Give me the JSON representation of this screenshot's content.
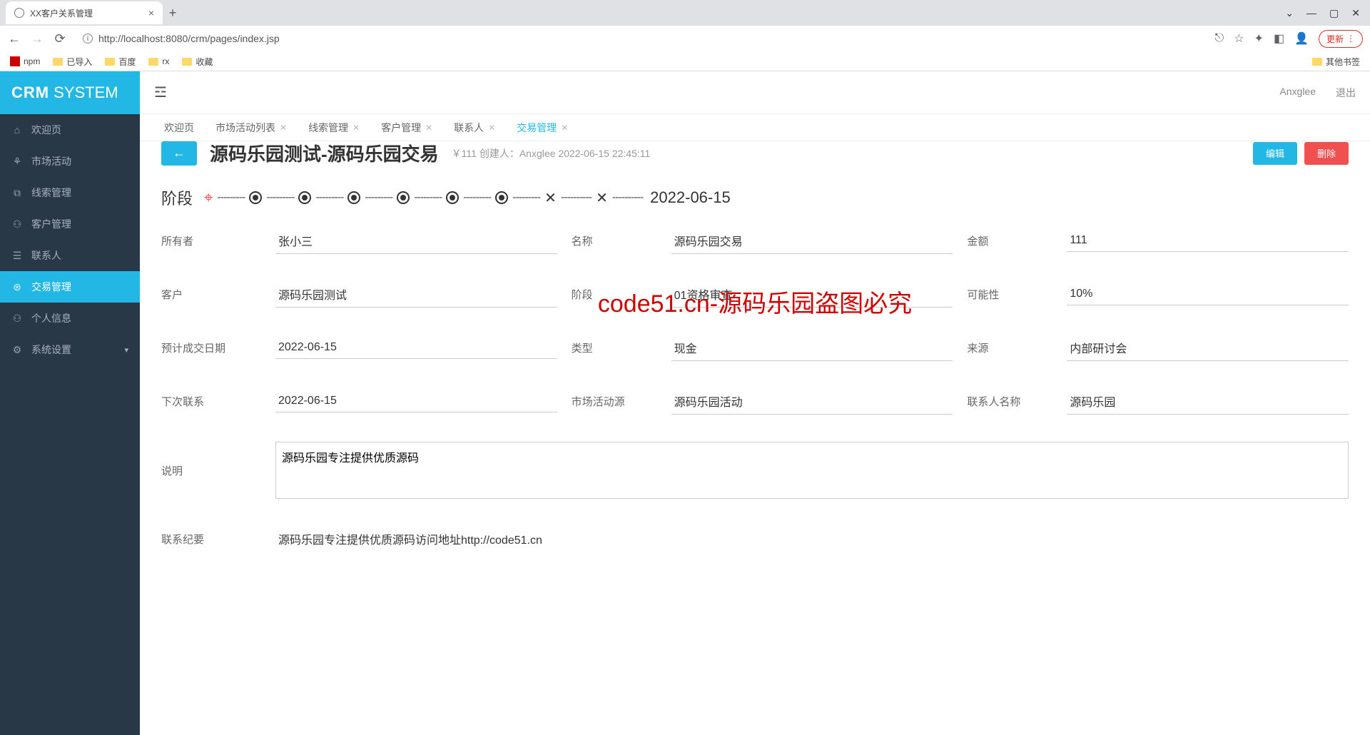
{
  "browser": {
    "tab_title": "XX客户关系管理",
    "url": "http://localhost:8080/crm/pages/index.jsp",
    "update_btn": "更新",
    "bookmarks": [
      "npm",
      "已导入",
      "百度",
      "rx",
      "收藏"
    ],
    "other_bookmarks": "其他书签"
  },
  "app": {
    "logo_bold": "CRM",
    "logo_light": "SYSTEM",
    "user": "Anxglee",
    "logout": "退出"
  },
  "sidebar": [
    {
      "icon": "⌂",
      "label": "欢迎页"
    },
    {
      "icon": "⚘",
      "label": "市场活动"
    },
    {
      "icon": "⧉",
      "label": "线索管理"
    },
    {
      "icon": "⚇",
      "label": "客户管理"
    },
    {
      "icon": "☰",
      "label": "联系人"
    },
    {
      "icon": "⊛",
      "label": "交易管理",
      "active": true
    },
    {
      "icon": "⚇",
      "label": "个人信息"
    },
    {
      "icon": "⚙",
      "label": "系统设置",
      "expand": true
    }
  ],
  "tabs": [
    {
      "label": "欢迎页",
      "closable": false
    },
    {
      "label": "市场活动列表",
      "closable": true
    },
    {
      "label": "线索管理",
      "closable": true
    },
    {
      "label": "客户管理",
      "closable": true
    },
    {
      "label": "联系人",
      "closable": true
    },
    {
      "label": "交易管理",
      "closable": true,
      "active": true
    }
  ],
  "detail": {
    "title": "源码乐园测试-源码乐园交易",
    "price": "￥111",
    "creator_label": "创建人：",
    "creator": "Anxglee 2022-06-15 22:45:11",
    "edit_btn": "编辑",
    "delete_btn": "删除",
    "stage_label": "阶段",
    "stage_date": "2022-06-15"
  },
  "fields": {
    "owner_l": "所有者",
    "owner_v": "张小三",
    "name_l": "名称",
    "name_v": "源码乐园交易",
    "amount_l": "金额",
    "amount_v": "111",
    "customer_l": "客户",
    "customer_v": "源码乐园测试",
    "stage_l": "阶段",
    "stage_v": "01资格审查",
    "possibility_l": "可能性",
    "possibility_v": "10%",
    "expect_l": "预计成交日期",
    "expect_v": "2022-06-15",
    "type_l": "类型",
    "type_v": "现金",
    "source_l": "来源",
    "source_v": "内部研讨会",
    "next_l": "下次联系",
    "next_v": "2022-06-15",
    "activity_l": "市场活动源",
    "activity_v": "源码乐园活动",
    "contact_l": "联系人名称",
    "contact_v": "源码乐园",
    "desc_l": "说明",
    "desc_v": "源码乐园专注提供优质源码",
    "summary_l": "联系纪要",
    "summary_v": "源码乐园专注提供优质源码访问地址http://code51.cn"
  },
  "watermark": "code51.cn-源码乐园盗图必究"
}
